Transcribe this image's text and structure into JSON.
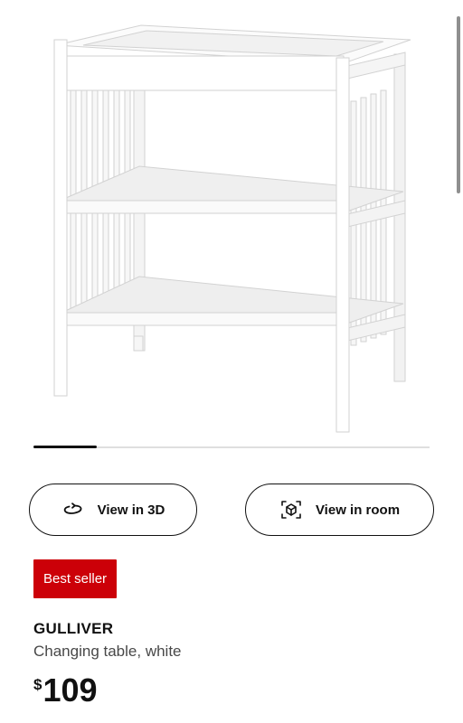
{
  "gallery": {
    "image_alt": "GULLIVER Changing table, white",
    "slide_progress": 0.16
  },
  "actions": {
    "view_3d_label": "View in 3D",
    "view_room_label": "View in room"
  },
  "badge": {
    "label": "Best seller",
    "color": "#CC0008"
  },
  "product": {
    "name": "GULLIVER",
    "description": "Changing table, white"
  },
  "price": {
    "currency_symbol": "$",
    "amount": "109"
  }
}
